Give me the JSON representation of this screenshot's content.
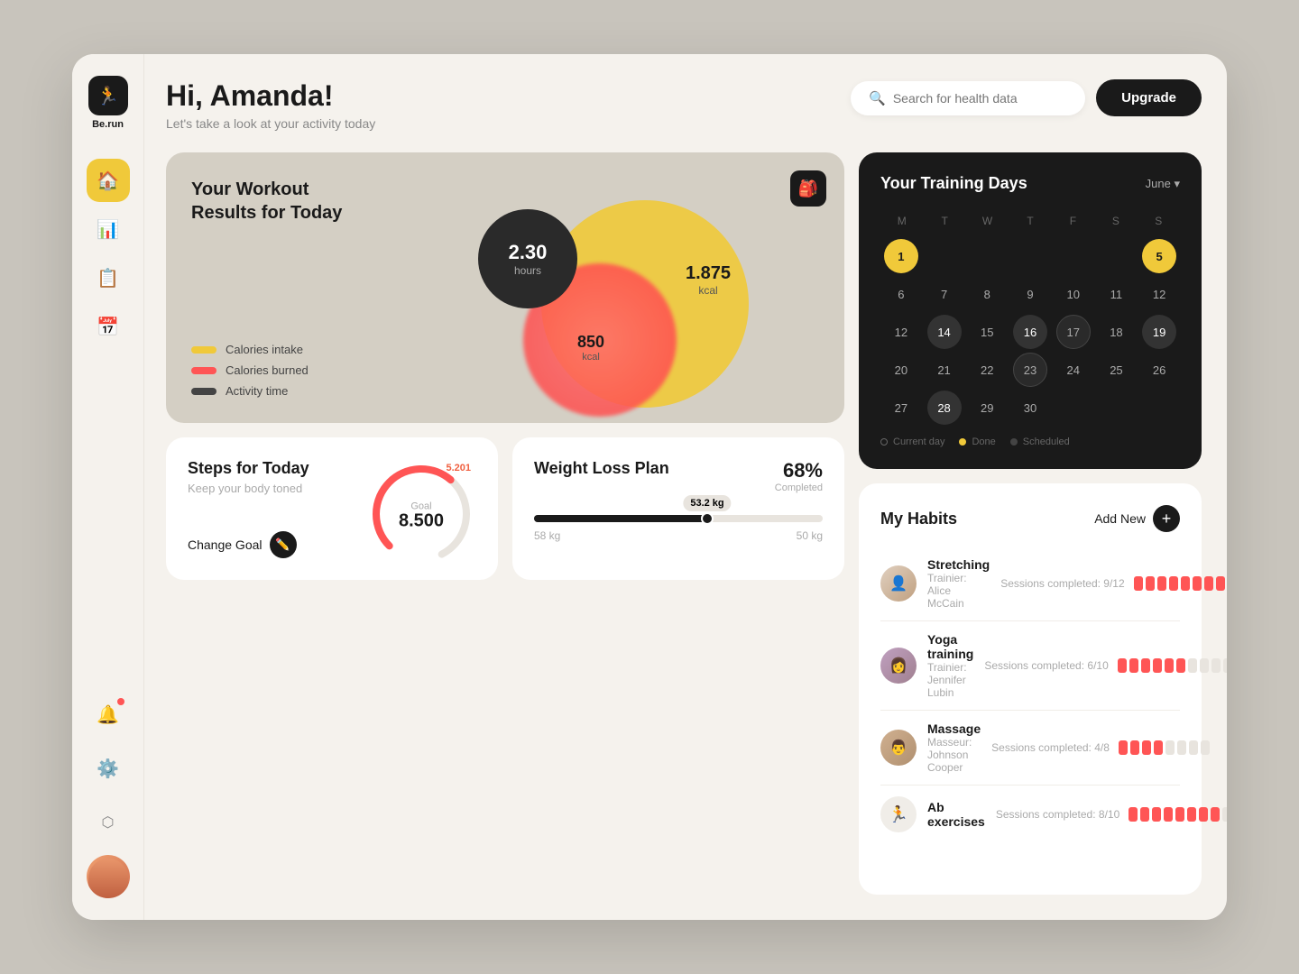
{
  "app": {
    "logo_text": "Be.run",
    "logo_icon": "🏃"
  },
  "header": {
    "greeting": "Hi, Amanda!",
    "subtitle": "Let's take a look at your activity today",
    "search_placeholder": "Search for health data",
    "upgrade_label": "Upgrade"
  },
  "sidebar": {
    "items": [
      {
        "id": "home",
        "icon": "🏠",
        "label": "Home",
        "active": true
      },
      {
        "id": "activity",
        "icon": "📊",
        "label": "Activity",
        "active": false
      },
      {
        "id": "notes",
        "icon": "📋",
        "label": "Notes",
        "active": false
      },
      {
        "id": "calendar",
        "icon": "📅",
        "label": "Calendar",
        "active": false
      },
      {
        "id": "notifications",
        "icon": "🔔",
        "label": "Notifications",
        "active": false
      },
      {
        "id": "settings",
        "icon": "⚙️",
        "label": "Settings",
        "active": false
      }
    ]
  },
  "workout": {
    "title_line1": "Your Workout",
    "title_line2": "Results for Today",
    "activity_time_value": "2.30",
    "activity_time_unit": "hours",
    "calories_intake_value": "1.875",
    "calories_intake_unit": "kcal",
    "calories_burned_value": "850",
    "calories_burned_unit": "kcal",
    "legend": [
      {
        "id": "intake",
        "label": "Calories intake",
        "color": "#f0c93a"
      },
      {
        "id": "burned",
        "label": "Calories burned",
        "color": "#ff5555"
      },
      {
        "id": "activity",
        "label": "Activity time",
        "color": "#444"
      }
    ]
  },
  "calendar": {
    "title": "Your Training Days",
    "month": "June",
    "day_headers": [
      "M",
      "T",
      "W",
      "T",
      "F",
      "S",
      "S"
    ],
    "legend": [
      {
        "id": "current",
        "label": "Current day",
        "color": "#555"
      },
      {
        "id": "done",
        "label": "Done",
        "color": "#f0c93a"
      },
      {
        "id": "scheduled",
        "label": "Scheduled",
        "color": "#444"
      }
    ],
    "weeks": [
      [
        null,
        null,
        null,
        null,
        null,
        null,
        "5"
      ],
      [
        "6",
        "7",
        "8",
        "9",
        "10",
        "11",
        "12"
      ],
      [
        "12",
        "14",
        "15",
        "16",
        "17",
        "18",
        "19"
      ],
      [
        "20",
        "21",
        "22",
        "23",
        "24",
        "25",
        "26"
      ],
      [
        "27",
        "28",
        "29",
        "30",
        null,
        null,
        null
      ]
    ],
    "current_day": "1",
    "done_days": [
      "14",
      "16",
      "28"
    ],
    "scheduled_days": [
      "17",
      "19",
      "23"
    ],
    "first_row_special": "1"
  },
  "steps": {
    "title": "Steps for Today",
    "subtitle": "Keep your body toned",
    "change_goal_label": "Change Goal",
    "current_steps": "5.201",
    "goal_steps": "8.500",
    "goal_label": "Goal"
  },
  "weight": {
    "title": "Weight Loss Plan",
    "completed_pct": "68%",
    "completed_label": "Completed",
    "current_weight": "53.2 kg",
    "start_weight": "58 kg",
    "target_weight": "50 kg"
  },
  "habits": {
    "title": "My Habits",
    "add_new_label": "Add New",
    "items": [
      {
        "id": "stretching",
        "name": "Stretching",
        "trainer": "Trainier: Alice McCain",
        "sessions_label": "Sessions completed:",
        "sessions_done": 9,
        "sessions_total": 12,
        "avatar_type": "person1",
        "avatar_icon": "👤"
      },
      {
        "id": "yoga",
        "name": "Yoga training",
        "trainer": "Trainier: Jennifer Lubin",
        "sessions_label": "Sessions completed:",
        "sessions_done": 6,
        "sessions_total": 10,
        "avatar_type": "person2",
        "avatar_icon": "👩"
      },
      {
        "id": "massage",
        "name": "Massage",
        "trainer": "Masseur: Johnson Cooper",
        "sessions_label": "Sessions completed:",
        "sessions_done": 4,
        "sessions_total": 8,
        "avatar_type": "person3",
        "avatar_icon": "👨"
      },
      {
        "id": "ab-exercises",
        "name": "Ab exercises",
        "trainer": "",
        "sessions_label": "Sessions completed:",
        "sessions_done": 8,
        "sessions_total": 10,
        "avatar_type": "icon-only",
        "avatar_icon": "🏃"
      }
    ]
  }
}
